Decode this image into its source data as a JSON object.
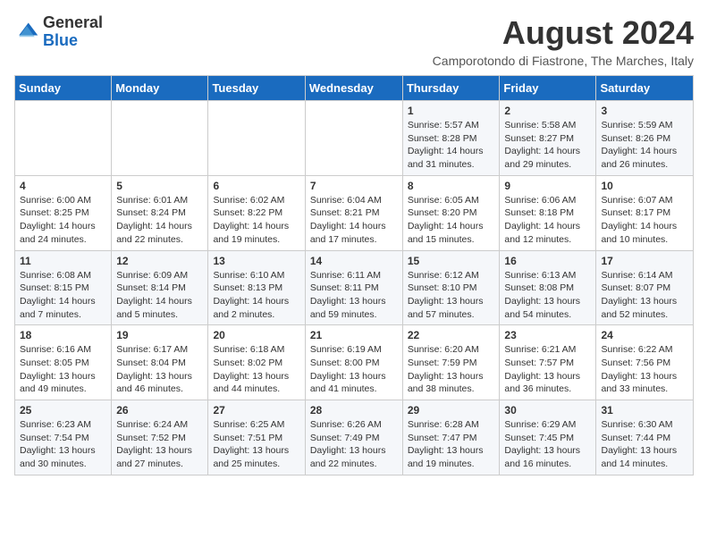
{
  "header": {
    "logo_general": "General",
    "logo_blue": "Blue",
    "title": "August 2024",
    "location": "Camporotondo di Fiastrone, The Marches, Italy"
  },
  "days_of_week": [
    "Sunday",
    "Monday",
    "Tuesday",
    "Wednesday",
    "Thursday",
    "Friday",
    "Saturday"
  ],
  "weeks": [
    [
      {
        "day": "",
        "info": ""
      },
      {
        "day": "",
        "info": ""
      },
      {
        "day": "",
        "info": ""
      },
      {
        "day": "",
        "info": ""
      },
      {
        "day": "1",
        "info": "Sunrise: 5:57 AM\nSunset: 8:28 PM\nDaylight: 14 hours and 31 minutes."
      },
      {
        "day": "2",
        "info": "Sunrise: 5:58 AM\nSunset: 8:27 PM\nDaylight: 14 hours and 29 minutes."
      },
      {
        "day": "3",
        "info": "Sunrise: 5:59 AM\nSunset: 8:26 PM\nDaylight: 14 hours and 26 minutes."
      }
    ],
    [
      {
        "day": "4",
        "info": "Sunrise: 6:00 AM\nSunset: 8:25 PM\nDaylight: 14 hours and 24 minutes."
      },
      {
        "day": "5",
        "info": "Sunrise: 6:01 AM\nSunset: 8:24 PM\nDaylight: 14 hours and 22 minutes."
      },
      {
        "day": "6",
        "info": "Sunrise: 6:02 AM\nSunset: 8:22 PM\nDaylight: 14 hours and 19 minutes."
      },
      {
        "day": "7",
        "info": "Sunrise: 6:04 AM\nSunset: 8:21 PM\nDaylight: 14 hours and 17 minutes."
      },
      {
        "day": "8",
        "info": "Sunrise: 6:05 AM\nSunset: 8:20 PM\nDaylight: 14 hours and 15 minutes."
      },
      {
        "day": "9",
        "info": "Sunrise: 6:06 AM\nSunset: 8:18 PM\nDaylight: 14 hours and 12 minutes."
      },
      {
        "day": "10",
        "info": "Sunrise: 6:07 AM\nSunset: 8:17 PM\nDaylight: 14 hours and 10 minutes."
      }
    ],
    [
      {
        "day": "11",
        "info": "Sunrise: 6:08 AM\nSunset: 8:15 PM\nDaylight: 14 hours and 7 minutes."
      },
      {
        "day": "12",
        "info": "Sunrise: 6:09 AM\nSunset: 8:14 PM\nDaylight: 14 hours and 5 minutes."
      },
      {
        "day": "13",
        "info": "Sunrise: 6:10 AM\nSunset: 8:13 PM\nDaylight: 14 hours and 2 minutes."
      },
      {
        "day": "14",
        "info": "Sunrise: 6:11 AM\nSunset: 8:11 PM\nDaylight: 13 hours and 59 minutes."
      },
      {
        "day": "15",
        "info": "Sunrise: 6:12 AM\nSunset: 8:10 PM\nDaylight: 13 hours and 57 minutes."
      },
      {
        "day": "16",
        "info": "Sunrise: 6:13 AM\nSunset: 8:08 PM\nDaylight: 13 hours and 54 minutes."
      },
      {
        "day": "17",
        "info": "Sunrise: 6:14 AM\nSunset: 8:07 PM\nDaylight: 13 hours and 52 minutes."
      }
    ],
    [
      {
        "day": "18",
        "info": "Sunrise: 6:16 AM\nSunset: 8:05 PM\nDaylight: 13 hours and 49 minutes."
      },
      {
        "day": "19",
        "info": "Sunrise: 6:17 AM\nSunset: 8:04 PM\nDaylight: 13 hours and 46 minutes."
      },
      {
        "day": "20",
        "info": "Sunrise: 6:18 AM\nSunset: 8:02 PM\nDaylight: 13 hours and 44 minutes."
      },
      {
        "day": "21",
        "info": "Sunrise: 6:19 AM\nSunset: 8:00 PM\nDaylight: 13 hours and 41 minutes."
      },
      {
        "day": "22",
        "info": "Sunrise: 6:20 AM\nSunset: 7:59 PM\nDaylight: 13 hours and 38 minutes."
      },
      {
        "day": "23",
        "info": "Sunrise: 6:21 AM\nSunset: 7:57 PM\nDaylight: 13 hours and 36 minutes."
      },
      {
        "day": "24",
        "info": "Sunrise: 6:22 AM\nSunset: 7:56 PM\nDaylight: 13 hours and 33 minutes."
      }
    ],
    [
      {
        "day": "25",
        "info": "Sunrise: 6:23 AM\nSunset: 7:54 PM\nDaylight: 13 hours and 30 minutes."
      },
      {
        "day": "26",
        "info": "Sunrise: 6:24 AM\nSunset: 7:52 PM\nDaylight: 13 hours and 27 minutes."
      },
      {
        "day": "27",
        "info": "Sunrise: 6:25 AM\nSunset: 7:51 PM\nDaylight: 13 hours and 25 minutes."
      },
      {
        "day": "28",
        "info": "Sunrise: 6:26 AM\nSunset: 7:49 PM\nDaylight: 13 hours and 22 minutes."
      },
      {
        "day": "29",
        "info": "Sunrise: 6:28 AM\nSunset: 7:47 PM\nDaylight: 13 hours and 19 minutes."
      },
      {
        "day": "30",
        "info": "Sunrise: 6:29 AM\nSunset: 7:45 PM\nDaylight: 13 hours and 16 minutes."
      },
      {
        "day": "31",
        "info": "Sunrise: 6:30 AM\nSunset: 7:44 PM\nDaylight: 13 hours and 14 minutes."
      }
    ]
  ]
}
